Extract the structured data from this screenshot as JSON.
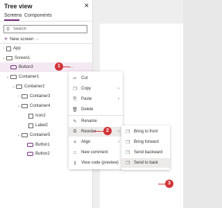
{
  "panel": {
    "title": "Tree view",
    "close_glyph": "✕",
    "tabs": [
      {
        "label": "Screens",
        "active": true
      },
      {
        "label": "Components",
        "active": false
      }
    ],
    "search": {
      "placeholder": "Search",
      "icon": "search-icon"
    },
    "new_screen_label": "New screen"
  },
  "tree": [
    {
      "label": "App",
      "icon": "app-icon"
    },
    {
      "label": "Screen1",
      "icon": "screen-icon"
    },
    {
      "label": "Button3",
      "icon": "button-icon",
      "selected": true
    },
    {
      "label": "Container1",
      "icon": "container-icon"
    },
    {
      "label": "Container2",
      "icon": "container-icon"
    },
    {
      "label": "Container3",
      "icon": "container-icon"
    },
    {
      "label": "Container4",
      "icon": "container-icon"
    },
    {
      "label": "Icon2",
      "icon": "icon-icon"
    },
    {
      "label": "Label2",
      "icon": "label-icon"
    },
    {
      "label": "Container5",
      "icon": "container-icon"
    },
    {
      "label": "Button1",
      "icon": "button-icon"
    },
    {
      "label": "Button2",
      "icon": "button-icon"
    }
  ],
  "context_menu": {
    "items": [
      {
        "label": "Cut",
        "icon": "scissors-icon"
      },
      {
        "label": "Copy",
        "icon": "copy-icon"
      },
      {
        "label": "Paste",
        "icon": "paste-icon"
      },
      {
        "label": "Delete",
        "icon": "trash-icon"
      },
      {
        "label": "Rename",
        "icon": "rename-icon"
      },
      {
        "label": "Reorder",
        "icon": "reorder-icon"
      },
      {
        "label": "Align",
        "icon": "align-icon"
      },
      {
        "label": "New comment",
        "icon": "comment-icon"
      },
      {
        "label": "View code (preview)",
        "icon": "code-icon"
      }
    ]
  },
  "submenu": {
    "items": [
      {
        "label": "Bring to front",
        "icon": "bring-to-front-icon"
      },
      {
        "label": "Bring forward",
        "icon": "bring-forward-icon"
      },
      {
        "label": "Send backward",
        "icon": "send-backward-icon"
      },
      {
        "label": "Send to back",
        "icon": "send-to-back-icon"
      }
    ]
  },
  "annotations": {
    "step1": "1",
    "step2": "2",
    "step3": "3",
    "color": "#d13438"
  },
  "colors": {
    "accent": "#742774",
    "selected_bg": "#f3e9f3",
    "hover_bg": "#edebe9"
  }
}
